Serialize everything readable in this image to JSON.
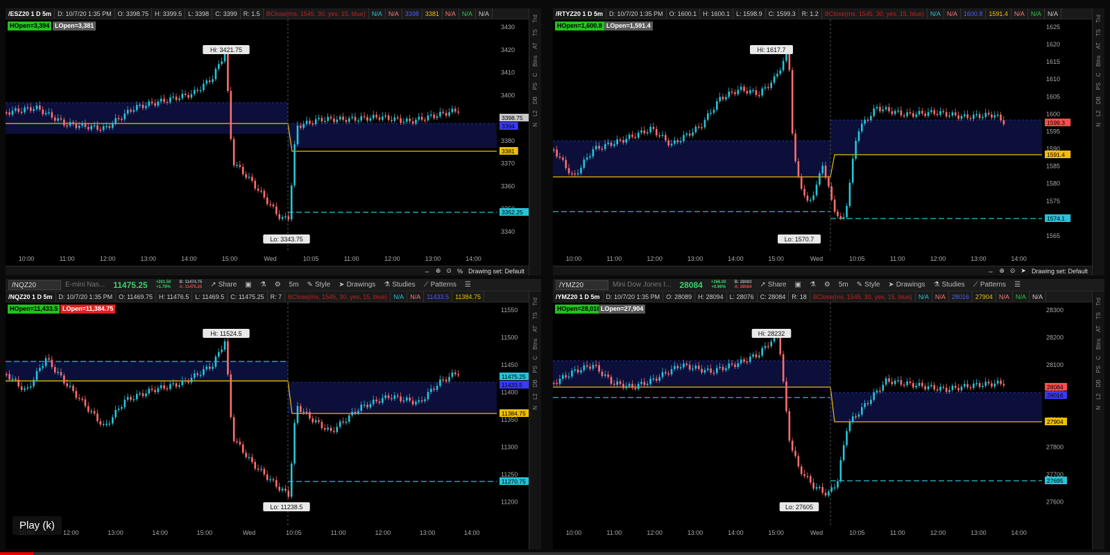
{
  "panels": [
    {
      "header": {
        "symbol": "/ESZ20 1 D 5m",
        "date": "D: 10/7/20 1:35 PM",
        "open": "O: 3398.75",
        "high": "H: 3399.5",
        "low": "L: 3398",
        "close": "C: 3399",
        "range": "R: 1.5",
        "study": "BClose(ms, 1545, 30, yes, 15, blue)",
        "na1": "N/A",
        "na2": "N/A",
        "blue_val": "3398",
        "yellow_val": "3381",
        "na3": "N/A",
        "na4": "N/A",
        "na5": "N/A"
      },
      "hopen": "HOpen=3,394",
      "lopen": "LOpen=3,381",
      "hi_label": "Hi: 3421.75",
      "lo_label": "Lo: 3343.75",
      "y_ticks": [
        "3430",
        "3420",
        "3410",
        "3400",
        "3390",
        "3380",
        "3370",
        "3360",
        "3350",
        "3340"
      ],
      "x_ticks": [
        "10:00",
        "11:00",
        "12:00",
        "13:00",
        "14:00",
        "15:00",
        "Wed",
        "10:05",
        "11:00",
        "12:00",
        "13:00",
        "14:00"
      ],
      "price_labels": [
        {
          "text": "3398.75",
          "color": "#c8c8c8"
        },
        {
          "text": "3394",
          "color": "#3a3aff"
        },
        {
          "text": "3381",
          "color": "#f0c000"
        },
        {
          "text": "3352.25",
          "color": "#27c3d6"
        }
      ],
      "footer_label": "Drawing set: Default"
    },
    {
      "header": {
        "symbol": "/RTYZ20 1 D 5m",
        "date": "D: 10/7/20 1:35 PM",
        "open": "O: 1600.1",
        "high": "H: 1600.1",
        "low": "L: 1598.9",
        "close": "C: 1599.3",
        "range": "R: 1.2",
        "study": "BClose(ms, 1545, 30, yes, 15, blue)",
        "na1": "N/A",
        "na2": "N/A",
        "blue_val": "1600.8",
        "yellow_val": "1591.4",
        "na3": "N/A",
        "na4": "N/A",
        "na5": "N/A"
      },
      "hopen": "HOpen=1,600.8",
      "lopen": "LOpen=1,591.4",
      "hi_label": "Hi: 1617.7",
      "lo_label": "Lo: 1570.7",
      "y_ticks": [
        "1625",
        "1620",
        "1615",
        "1610",
        "1605",
        "1600",
        "1595",
        "1590",
        "1585",
        "1580",
        "1575",
        "1570",
        "1565"
      ],
      "x_ticks": [
        "10:00",
        "11:00",
        "12:00",
        "13:00",
        "14:00",
        "15:00",
        "Wed",
        "10:05",
        "11:00",
        "12:00",
        "13:00",
        "14:00"
      ],
      "price_labels": [
        {
          "text": "1599.3",
          "color": "#ff4d4d"
        },
        {
          "text": "1591.4",
          "color": "#f0c000"
        },
        {
          "text": "1574.1",
          "color": "#27c3d6"
        }
      ],
      "footer_label": "Drawing set: Default"
    },
    {
      "tools": {
        "symbol": "/NQZ20",
        "name": "E-mini Nas...",
        "last": "11475.25",
        "chg": "+201.50",
        "pct": "+1.79%",
        "bid": "B: 11474.75",
        "ask": "A: 11475.25",
        "share": "Share",
        "tf": "5m",
        "style": "Style",
        "drawings": "Drawings",
        "studies": "Studies",
        "patterns": "Patterns"
      },
      "header": {
        "symbol": "/NQZ20 1 D 5m",
        "date": "D: 10/7/20 1:35 PM",
        "open": "O: 11469.75",
        "high": "H: 11476.5",
        "low": "L: 11469.5",
        "close": "C: 11475.25",
        "range": "R: 7",
        "study": "BClose(ms, 1545, 30, yes, 15, blue)",
        "na1": "N/A",
        "na2": "N/A",
        "blue_val": "11433.5",
        "yellow_val": "11384.75",
        "na3": "",
        "na4": "",
        "na5": ""
      },
      "hopen": "HOpen=11,433.5",
      "lopen": "LOpen=11,384.75",
      "hi_label": "Hi: 11524.5",
      "lo_label": "Lo: 11238.5",
      "y_ticks": [
        "11550",
        "11500",
        "11450",
        "11400",
        "11350",
        "11300",
        "11250",
        "11200"
      ],
      "x_ticks": [
        "11:00",
        "12:00",
        "13:00",
        "14:00",
        "15:00",
        "Wed",
        "10:05",
        "11:00",
        "12:00",
        "13:00",
        "14:00"
      ],
      "price_labels": [
        {
          "text": "11475.25",
          "color": "#27c3d6"
        },
        {
          "text": "11433.5",
          "color": "#3a3aff"
        },
        {
          "text": "11384.75",
          "color": "#f0c000"
        },
        {
          "text": "11270.75",
          "color": "#27c3d6"
        }
      ],
      "footer_label": ""
    },
    {
      "tools": {
        "symbol": "/YMZ20",
        "name": "Mini Dow Jones I...",
        "last": "28084",
        "chg": "+266.00",
        "pct": "+0.96%",
        "bid": "B: 28083",
        "ask": "A: 28084",
        "share": "Share",
        "tf": "5m",
        "style": "Style",
        "drawings": "Drawings",
        "studies": "Studies",
        "patterns": "Patterns"
      },
      "header": {
        "symbol": "/YMZ20 1 D 5m",
        "date": "D: 10/7/20 1:35 PM",
        "open": "O: 28089",
        "high": "H: 28094",
        "low": "L: 28076",
        "close": "C: 28084",
        "range": "R: 18",
        "study": "BClose(ms, 1545, 30, yes, 15, blue)",
        "na1": "N/A",
        "na2": "N/A",
        "blue_val": "28016",
        "yellow_val": "27904",
        "na3": "N/A",
        "na4": "N/A",
        "na5": "N/A"
      },
      "hopen": "HOpen=28,016",
      "lopen": "LOpen=27,904",
      "hi_label": "Hi: 28232",
      "lo_label": "Lo: 27605",
      "y_ticks": [
        "28300",
        "28200",
        "28100",
        "28000",
        "27900",
        "27800",
        "27700",
        "27600"
      ],
      "x_ticks": [
        "10:00",
        "11:00",
        "12:00",
        "13:00",
        "14:00",
        "15:00",
        "Wed",
        "10:05",
        "11:00",
        "12:00",
        "13:00",
        "14:00"
      ],
      "price_labels": [
        {
          "text": "28084",
          "color": "#ff4d4d"
        },
        {
          "text": "28016",
          "color": "#3a3aff"
        },
        {
          "text": "27904",
          "color": "#f0c000"
        },
        {
          "text": "27695",
          "color": "#27c3d6"
        }
      ],
      "footer_label": ""
    }
  ],
  "right_strip": [
    "Trd",
    "TS",
    "AT",
    "Btns",
    "C",
    "PS",
    "DB",
    "L2",
    "N"
  ],
  "player": {
    "play_label": "Play (k)",
    "progress_percent": 3
  },
  "colors": {
    "up": "#26c6da",
    "down": "#ff6e6e",
    "hopen": "#f0c000",
    "level": "#27c3d6",
    "zone": "#0b0f3a"
  }
}
